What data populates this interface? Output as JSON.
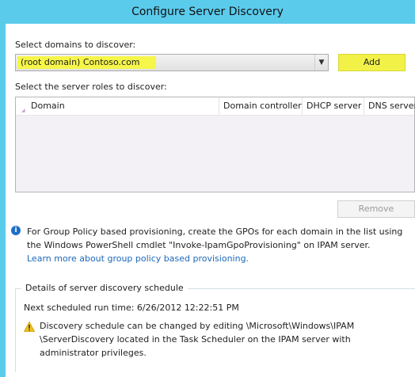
{
  "window": {
    "title": "Configure Server Discovery"
  },
  "domains": {
    "label": "Select domains to discover:",
    "selected": "(root domain) Contoso.com",
    "add_label": "Add"
  },
  "roles": {
    "label": "Select the server roles to discover:",
    "columns": [
      "Domain",
      "Domain controller",
      "DHCP server",
      "DNS server"
    ],
    "remove_label": "Remove"
  },
  "info": {
    "text": "For Group Policy based provisioning, create the GPOs for each domain in the list using the Windows PowerShell cmdlet \"Invoke-IpamGpoProvisioning\" on IPAM server.",
    "link": "Learn more about group policy based provisioning."
  },
  "schedule": {
    "title": "Details of server discovery schedule",
    "next_run": "Next scheduled run time: 6/26/2012 12:22:51 PM",
    "warning": "Discovery schedule can be changed by editing \\Microsoft\\Windows\\IPAM \\ServerDiscovery located in the Task Scheduler on the IPAM server with administrator privileges."
  },
  "colors": {
    "accent": "#5bcbec",
    "highlight": "#f6f64a",
    "link": "#1d68b8"
  },
  "icons": {
    "info": "info-icon",
    "warning": "warning-icon",
    "dropdown": "chevron-down-icon"
  }
}
